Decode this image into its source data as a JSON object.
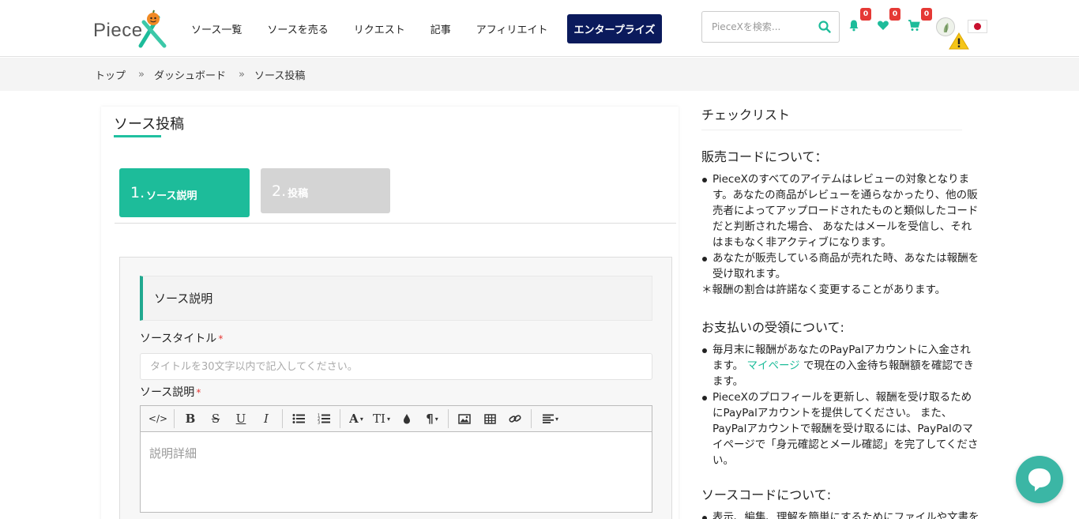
{
  "header": {
    "logo_text": "Piece",
    "nav": [
      "ソース一覧",
      "ソースを売る",
      "リクエスト",
      "記事",
      "アフィリエイト"
    ],
    "enterprise_label": "エンタープライズ",
    "search_placeholder": "PieceXを検索...",
    "badges": {
      "notifications": "0",
      "favorites": "0",
      "cart": "0"
    },
    "colors": {
      "accent": "#1dbc9a",
      "enterprise_bg": "#0b1a5c",
      "badge": "#e53935"
    }
  },
  "breadcrumb": [
    "トップ",
    "ダッシュボード",
    "ソース投稿"
  ],
  "breadcrumb_sep": "»",
  "main": {
    "title": "ソース投稿",
    "steps": [
      {
        "num": "1.",
        "label": "ソース説明"
      },
      {
        "num": "2.",
        "label": "投稿"
      }
    ],
    "section_head": "ソース説明",
    "title_label": "ソースタイトル",
    "title_placeholder": "タイトルを30文字以内で記入してください。",
    "description_label": "ソース説明",
    "required_mark": "*",
    "editor_placeholder": "説明詳細",
    "toolbar_icons": [
      "code-view-icon",
      "bold-icon",
      "strikethrough-icon",
      "underline-icon",
      "italic-icon",
      "bullet-list-icon",
      "ordered-list-icon",
      "font-color-icon",
      "font-size-icon",
      "color-drop-icon",
      "paragraph-icon",
      "image-icon",
      "table-icon",
      "link-icon",
      "align-icon"
    ]
  },
  "checklist": {
    "title": "チェックリスト",
    "sections": [
      {
        "heading": "販売コードについて：",
        "items": [
          "PieceXのすべてのアイテムはレビューの対象となります。あなたの商品がレビューを通らなかったり、他の販売者によってアップロードされたものと類似したコードだと判断された場合、 あなたはメールを受信し、それはまもなく非アクティブになります。",
          "あなたが販売している商品が売れた時、あなたは報酬を受け取れます。"
        ],
        "note": "＊報酬の割合は許諾なく変更することがあります。"
      },
      {
        "heading": "お支払いの受領について:",
        "item1_before": "毎月末に報酬があなたのPayPalアカウントに入金されます。",
        "item1_link": "マイページ",
        "item1_after": "で現在の入金待ち報酬額を確認できます。",
        "item2": "PieceXのプロフィールを更新し、報酬を受け取るためにPayPalアカウントを提供してください。 また、PayPalアカウントで報酬を受け取るには、PayPalのマイページで「身元確認とメール確認」を完了してください。"
      },
      {
        "heading": "ソースコードについて:",
        "items": [
          "表示、編集、理解を簡単にするためにファイルや文書を整理してください。"
        ]
      }
    ]
  }
}
